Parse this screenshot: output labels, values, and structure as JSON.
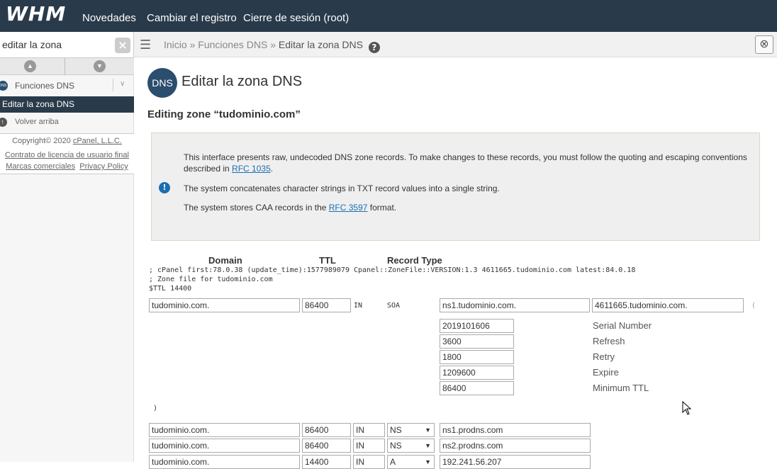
{
  "topbar": {
    "logo": "WHM",
    "nav": [
      "Novedades",
      "Cambiar el registro",
      "Cierre de sesión (root)"
    ]
  },
  "search": {
    "value": "editar la zona"
  },
  "breadcrumb": {
    "items": [
      "Inicio",
      "Funciones DNS",
      "Editar la zona DNS"
    ],
    "separator": "»"
  },
  "sidebar": {
    "category": "Funciones DNS",
    "active_item": "Editar la zona DNS",
    "back": "Volver arriba",
    "footer": {
      "copyright_prefix": "Copyright© 2020 ",
      "copyright_link": "cPanel, L.L.C.",
      "license": "Contrato de licencia de usuario final",
      "trademarks": "Marcas comerciales",
      "privacy": "Privacy Policy"
    }
  },
  "page": {
    "icon_text": "DNS",
    "title": "Editar la zona DNS",
    "zone_title": "Editing zone “tudominio.com”"
  },
  "notice": {
    "line1_a": "This interface presents raw, undecoded DNS zone records. To make changes to these records, you must follow the quoting and escaping conventions described in ",
    "line1_link": "RFC 1035",
    "line1_b": ".",
    "line2": "The system concatenates character strings in TXT record values into a single string.",
    "line3_a": "The system stores CAA records in the ",
    "line3_link": "RFC 3597",
    "line3_b": " format."
  },
  "table": {
    "headers": {
      "domain": "Domain",
      "ttl": "TTL",
      "type": "Record Type"
    },
    "comments": [
      "; cPanel first:78.0.38 (update_time):1577989079 Cpanel::ZoneFile::VERSION:1.3 4611665.tudominio.com latest:84.0.18",
      "; Zone file for tudominio.com",
      "$TTL 14400"
    ],
    "soa": {
      "domain": "tudominio.com.",
      "ttl": "86400",
      "class": "IN",
      "type": "SOA",
      "mname": "ns1.tudominio.com.",
      "rname": "4611665.tudominio.com.",
      "open_paren": "(",
      "close_paren": ")",
      "fields": [
        {
          "value": "2019101606",
          "label": "Serial Number"
        },
        {
          "value": "3600",
          "label": "Refresh"
        },
        {
          "value": "1800",
          "label": "Retry"
        },
        {
          "value": "1209600",
          "label": "Expire"
        },
        {
          "value": "86400",
          "label": "Minimum TTL"
        }
      ]
    },
    "records": [
      {
        "domain": "tudominio.com.",
        "ttl": "86400",
        "class": "IN",
        "type": "NS",
        "value": "ns1.prodns.com"
      },
      {
        "domain": "tudominio.com.",
        "ttl": "86400",
        "class": "IN",
        "type": "NS",
        "value": "ns2.prodns.com"
      },
      {
        "domain": "tudominio.com.",
        "ttl": "14400",
        "class": "IN",
        "type": "A",
        "value": "192.241.56.207"
      }
    ]
  },
  "colors": {
    "topbar": "#293a4a",
    "link": "#1a6fb0",
    "notice_bg": "#efefef"
  },
  "icons": [
    "menu-icon",
    "clear-icon",
    "help-icon",
    "lifesaver-icon",
    "info-icon",
    "dns-icon",
    "up-arrow-icon",
    "cursor-icon"
  ]
}
